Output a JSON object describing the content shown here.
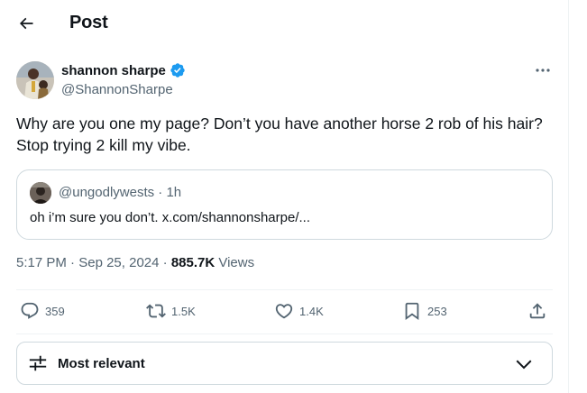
{
  "header": {
    "title": "Post"
  },
  "author": {
    "name": "shannon sharpe",
    "handle": "@ShannonSharpe",
    "verified": true
  },
  "post": {
    "text": "Why are you one my page? Don’t you have another horse 2 rob of his hair? Stop trying 2 kill my vibe."
  },
  "quote": {
    "handle": "@ungodlywests",
    "separator": "·",
    "age": "1h",
    "text": "oh i’m sure you don’t. x.com/shannonsharpe/..."
  },
  "meta": {
    "time": "5:17 PM",
    "date": "Sep 25, 2024",
    "separator": "·",
    "views_count": "885.7K",
    "views_label": "Views"
  },
  "actions": {
    "replies": "359",
    "reposts": "1.5K",
    "likes": "1.4K",
    "bookmarks": "253"
  },
  "sort": {
    "label": "Most relevant"
  },
  "colors": {
    "text": "#0f1419",
    "secondary": "#536471",
    "verified": "#1d9bf0",
    "border": "#cfd9de"
  },
  "icons": {
    "back": "arrow-left-icon",
    "verified": "verified-badge-icon",
    "more": "more-dots-icon",
    "reply": "reply-bubble-icon",
    "repost": "repost-icon",
    "like": "heart-icon",
    "bookmark": "bookmark-icon",
    "share": "share-upload-icon",
    "sort": "sliders-icon",
    "chevron": "chevron-down-icon"
  }
}
